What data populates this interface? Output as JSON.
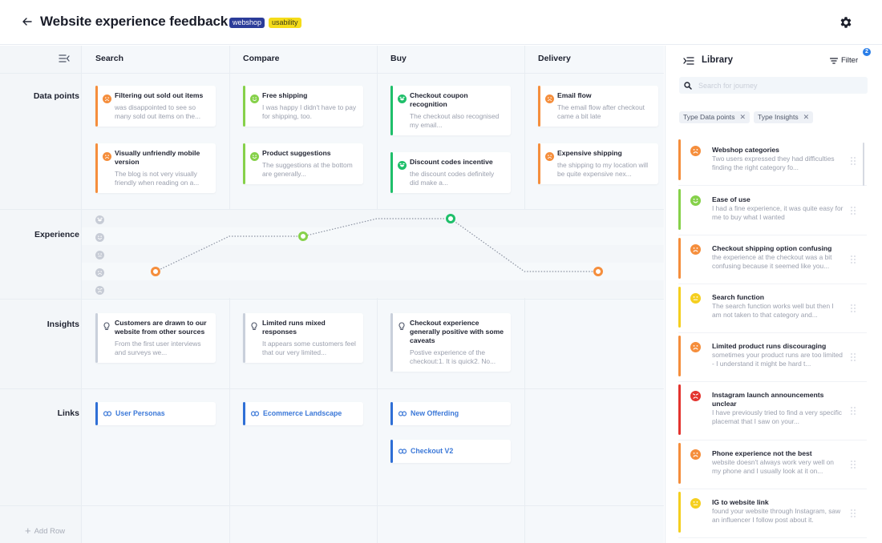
{
  "header": {
    "back_label": "←",
    "title": "Website experience feedback",
    "tags": [
      {
        "label": "webshop",
        "color": "#2b3c99"
      },
      {
        "label": "usability",
        "color": "#f5dc19"
      }
    ]
  },
  "board": {
    "stages": [
      "Search",
      "Compare",
      "Buy",
      "Delivery"
    ],
    "rows": [
      "Data points",
      "Experience",
      "Insights",
      "Links"
    ],
    "add_row_label": "Add Row",
    "data_points": [
      [
        {
          "title": "Filtering out sold out items",
          "desc": "was disappointed to see so many sold out items on the...",
          "sentiment": "sad"
        },
        {
          "title": "Visually unfriendly mobile version",
          "desc": "The blog is not very visually friendly when reading on a...",
          "sentiment": "sad"
        }
      ],
      [
        {
          "title": "Free shipping",
          "desc": "I was happy I didn't have to pay for shipping, too.",
          "sentiment": "happy"
        },
        {
          "title": "Product suggestions",
          "desc": "The suggestions at the bottom are generally...",
          "sentiment": "happy"
        }
      ],
      [
        {
          "title": "Checkout coupon recognition",
          "desc": "The checkout also recognised my email...",
          "sentiment": "very-happy"
        },
        {
          "title": "Discount codes incentive",
          "desc": "the discount codes definitely did make a...",
          "sentiment": "very-happy"
        }
      ],
      [
        {
          "title": "Email flow",
          "desc": "The email flow after checkout came a bit late",
          "sentiment": "sad"
        },
        {
          "title": "Expensive shipping",
          "desc": "the shipping to my location will be quite expensive nex...",
          "sentiment": "sad"
        }
      ]
    ],
    "experience": {
      "scale": [
        "very-happy",
        "happy",
        "neutral",
        "sad",
        "very-sad"
      ],
      "levels": [
        2,
        4,
        5,
        2
      ],
      "max_level": 5
    },
    "insights": [
      {
        "title": "Customers are drawn to our website from other sources",
        "desc": "From the first user interviews and surveys we..."
      },
      {
        "title": "Limited runs mixed responses",
        "desc": "It appears some customers feel that our very limited..."
      },
      {
        "title": "Checkout experience generally positive with some caveats",
        "desc": "Postive experience of the checkout:1. It is quick2. No..."
      },
      null
    ],
    "links": [
      [
        "User Personas"
      ],
      [
        "Ecommerce Landscape"
      ],
      [
        "New Offerding",
        "Checkout V2"
      ],
      []
    ]
  },
  "library": {
    "title": "Library",
    "filter_label": "Filter",
    "filter_count": "2",
    "search_placeholder": "Search for journey",
    "search_value": "",
    "chips": [
      "Type Data points",
      "Type Insights"
    ],
    "chip_remove": "✕",
    "items": [
      {
        "title": "Webshop categories",
        "desc": "Two users expressed they had difficulties finding the right category fo...",
        "sentiment": "sad"
      },
      {
        "title": "Ease of use",
        "desc": "I had a fine experience, it was quite easy for me to buy what I wanted",
        "sentiment": "happy"
      },
      {
        "title": "Checkout shipping option confusing",
        "desc": "the experience at the checkout was a bit confusing because it seemed like you...",
        "sentiment": "sad"
      },
      {
        "title": "Search function",
        "desc": "The search function works well but then I am not taken to that category and...",
        "sentiment": "neutral"
      },
      {
        "title": "Limited product runs discouraging",
        "desc": "sometimes your product runs are too limited - I understand it might be hard t...",
        "sentiment": "sad"
      },
      {
        "title": "Instagram launch announcements unclear",
        "desc": "I have previously tried to find a very specific placemat that I saw on your...",
        "sentiment": "very-sad"
      },
      {
        "title": "Phone experience not the best",
        "desc": "website doesn't always work very well on my phone and I usually look at it on...",
        "sentiment": "sad"
      },
      {
        "title": "IG to website link",
        "desc": "found your website through Instagram, saw an influencer I follow post about it.",
        "sentiment": "neutral"
      }
    ]
  },
  "colors": {
    "very-happy": "#1fbf6a",
    "happy": "#86d14a",
    "neutral": "#f5cf1f",
    "sad": "#f58e3c",
    "very-sad": "#e3342f",
    "insight": "#c9d0db",
    "link": "#2f6fd6",
    "scale_icon": "#c7ccd6"
  }
}
